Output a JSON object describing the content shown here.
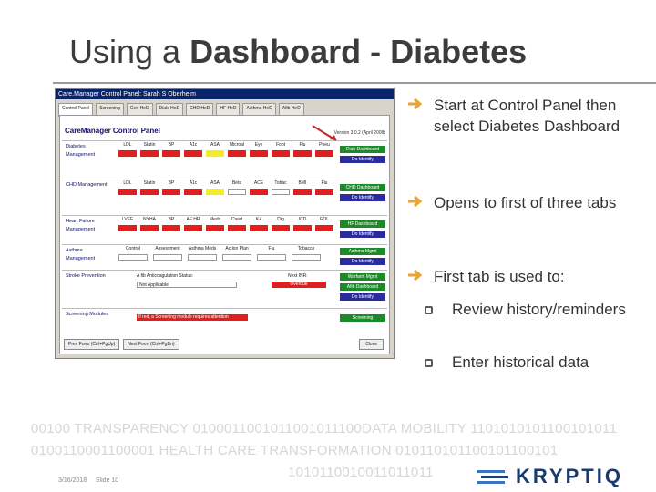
{
  "slide": {
    "title_prefix": "Using a ",
    "title_bold": "Dashboard - Diabetes",
    "footer_date": "3/16/2018",
    "footer_slide": "Slide 10"
  },
  "bullets": [
    {
      "text": "Start at Control Panel then select Diabetes Dashboard"
    },
    {
      "text": "Opens to first of three tabs"
    },
    {
      "text": "First tab is used to:"
    }
  ],
  "sub_bullets": [
    {
      "text": "Review history/reminders"
    },
    {
      "text": "Enter historical data"
    }
  ],
  "screenshot": {
    "window_title": "Care.Manager Control Panel:  Sarah S Oberheim",
    "tabs": [
      "Control Panel",
      "Screening",
      "Gen HeD",
      "Dials HeD",
      "CHD HeD",
      "HF HeD",
      "Asthma HeD",
      "Afib HeD"
    ],
    "heading": "CareManager Control Panel",
    "version": "Version 3.0.2 (April 2008)",
    "rows": [
      {
        "label": "Diabetes Management",
        "headers": [
          "LDL",
          "Statin",
          "BP",
          "A1c",
          "ASA",
          "Microal",
          "Eye",
          "Foot",
          "Flu",
          "Pneu"
        ],
        "cells": [
          "red",
          "red",
          "red",
          "red",
          "yel",
          "red",
          "red",
          "red",
          "red",
          "red"
        ],
        "btn1": "Diab Dashboard",
        "btn2": "Do Identify"
      },
      {
        "label": "CHD Management",
        "headers": [
          "LDL",
          "Statin",
          "BP",
          "A1c",
          "ASA",
          "Beta",
          "ACE",
          "Tobac",
          "BMI",
          "Flu"
        ],
        "cells": [
          "red",
          "red",
          "red",
          "red",
          "yel",
          "wht",
          "red",
          "wht",
          "red",
          "red"
        ],
        "btn1": "CHD Dashboard",
        "btn2": "Do Identify"
      },
      {
        "label": "Heart Failure Management",
        "headers": [
          "LVEF",
          "NYHA",
          "BP",
          "AF HR",
          "Meds",
          "Creat",
          "K+",
          "Dig",
          "ICD",
          "EOL"
        ],
        "cells": [
          "red",
          "red",
          "red",
          "red",
          "red",
          "red",
          "red",
          "red",
          "red",
          "red"
        ],
        "btn1": "HF Dashboard",
        "btn2": "Do Identify"
      },
      {
        "label": "Asthma Management",
        "headers": [
          "Control",
          "Assessment",
          "Asthma Meds",
          "Action Plan",
          "Flu",
          "Tobacco"
        ],
        "cells": [
          "wht",
          "wht",
          "wht",
          "wht",
          "wht",
          "wht"
        ],
        "btn1": "Asthma Mgmt",
        "btn2": "Do Identify"
      },
      {
        "label": "Stroke Prevention",
        "headers": [],
        "cells": [],
        "btn1": "Warfarin Mgmt",
        "btn2": "Afib Dashboard",
        "btn3": "Do Identify"
      },
      {
        "label": "Screening Modules",
        "headers": [],
        "cells": [],
        "btn1": "Screening"
      }
    ],
    "stroke_status_label": "A fib Anticoagulation Status:",
    "stroke_status_value": "Not Applicable",
    "stroke_next_inr": "Next INR:",
    "stroke_overdue": "Overdue",
    "screening_alert": "If red, a Screening module requires attention",
    "footer_prev": "Prev Form (Ctrl+PgUp)",
    "footer_next": "Next Form (Ctrl+PgDn)",
    "footer_close": "Close"
  },
  "watermark": {
    "line1": "00100 TRANSPARENCY 0100011001011001011100DATA MOBILITY 1101010101100101011",
    "line2": "0100110001100001 HEALTH CARE TRANSFORMATION 010110101100101100101",
    "line3": "1010110010011011011"
  },
  "logo": {
    "word": "KRYPTIQ"
  },
  "colors": {
    "arrow": "#e8a33a",
    "title": "#3c3c3c",
    "logo": "#1b3a6d"
  }
}
